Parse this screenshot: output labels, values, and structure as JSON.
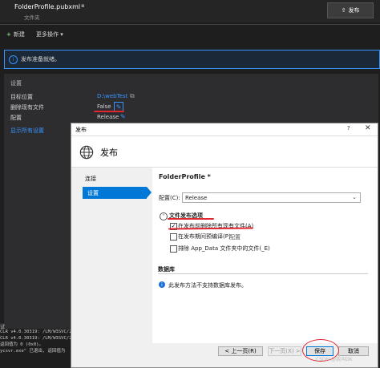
{
  "header": {
    "file_title": "FolderProfile.pubxml",
    "pin_icon": "pin-icon",
    "subtitle": "文件夹",
    "publish_button": "发布"
  },
  "toolbar": {
    "new_label": "新建",
    "more_actions_label": "更多操作"
  },
  "info_bar": {
    "message": "发布准备就绪。"
  },
  "settings": {
    "heading": "设置",
    "rows": [
      {
        "label": "目标位置",
        "value": "D:\\webTest"
      },
      {
        "label": "删除现有文件",
        "value": "False"
      },
      {
        "label": "配置",
        "value": "Release"
      }
    ],
    "show_all_link": "显示所有设置"
  },
  "terminal": {
    "title": "试",
    "lines": [
      "CLR v4.0.30319: /LM/W3SVC/2",
      "CLR v4.0.30319: /LM/W3SVC/2",
      "返回值为 0 (0x0)。",
      "ycsvr.exe\" 已退出, 返回值为"
    ]
  },
  "dialog": {
    "title": "发布",
    "help": "?",
    "close": "✕",
    "heading": "发布",
    "nav": [
      {
        "label": "连接",
        "selected": false
      },
      {
        "label": "设置",
        "selected": true
      }
    ],
    "profile_name": "FolderProfile *",
    "config_label": "配置(C):",
    "config_value": "Release",
    "file_options_heading": "文件发布选项",
    "options": [
      {
        "label": "在发布前删除所有现有文件(A)",
        "checked": true
      },
      {
        "label": "在发布期间预编译(P)",
        "checked": false
      },
      {
        "label": "排除 App_Data 文件夹中的文件(_E)",
        "checked": false
      }
    ],
    "configure_link": "配置",
    "database_heading": "数据库",
    "database_info": "此发布方法不支持数据库发布。",
    "buttons": {
      "prev": "< 上一页(R)",
      "next": "下一页(X) >",
      "save": "保存",
      "cancel": "取消"
    }
  },
  "watermark": "CSDN @我叫DK",
  "colors": {
    "accent": "#0078d7",
    "link": "#3794ff",
    "annotation": "#e0262e",
    "dark_bg": "#1e1e1e"
  }
}
